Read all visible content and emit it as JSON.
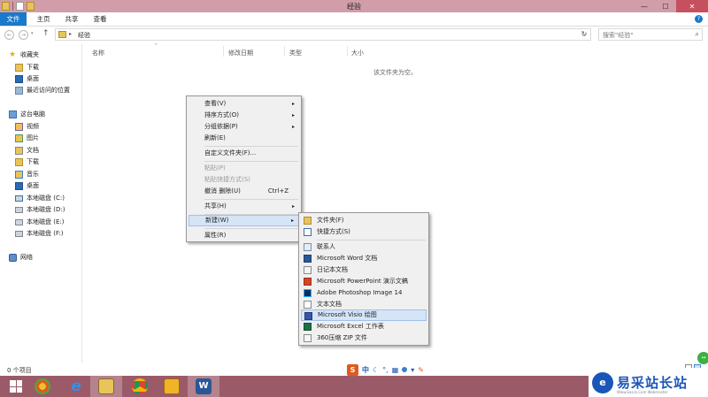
{
  "window": {
    "title": "经验",
    "controls": [
      "—",
      "☐",
      "✕"
    ]
  },
  "ribbon": {
    "tabs": [
      "文件",
      "主页",
      "共享",
      "查看"
    ]
  },
  "address": {
    "path": "经验",
    "search_placeholder": "搜索\"经验\""
  },
  "nav": {
    "favorites": "收藏夹",
    "fav_items": [
      "下载",
      "桌面",
      "最近访问的位置"
    ],
    "this_pc": "这台电脑",
    "pc_items": [
      "视频",
      "图片",
      "文档",
      "下载",
      "音乐",
      "桌面",
      "本地磁盘 (C:)",
      "本地磁盘 (D:)",
      "本地磁盘 (E:)",
      "本地磁盘 (F:)"
    ],
    "network": "网络"
  },
  "columns": [
    "名称",
    "修改日期",
    "类型",
    "大小"
  ],
  "empty_text": "该文件夹为空。",
  "context_menu": {
    "items": [
      {
        "label": "查看(V)",
        "arrow": "▸"
      },
      {
        "label": "排序方式(O)",
        "arrow": "▸"
      },
      {
        "label": "分组依据(P)",
        "arrow": "▸"
      },
      {
        "label": "刷新(E)"
      },
      {
        "label": "自定义文件夹(F)..."
      },
      {
        "label": "粘贴(P)"
      },
      {
        "label": "粘贴快捷方式(S)"
      },
      {
        "label": "撤消 删除(U)",
        "shortcut": "Ctrl+Z"
      },
      {
        "label": "共享(H)",
        "arrow": "▸"
      },
      {
        "label": "新建(W)",
        "arrow": "▸"
      },
      {
        "label": "属性(R)"
      }
    ]
  },
  "new_submenu": {
    "items": [
      "文件夹(F)",
      "快捷方式(S)",
      "联系人",
      "Microsoft Word 文档",
      "日记本文档",
      "Microsoft PowerPoint 演示文稿",
      "Adobe Photoshop Image 14",
      "文本文档",
      "Microsoft Visio 绘图",
      "Microsoft Excel 工作表",
      "360压缩 ZIP 文件"
    ]
  },
  "status": {
    "item_count": "0 个项目"
  },
  "ime": {
    "logo": "S",
    "mode": "中"
  },
  "watermark": {
    "logo": "e",
    "name": "易采站长站",
    "sub": "Www.Easck.Com Webmaster"
  },
  "colors": {
    "titlebar": "#d19da9",
    "taskbar": "#9b5a68",
    "accent": "#1979ca",
    "menu_highlight": "#d5e5f7"
  }
}
